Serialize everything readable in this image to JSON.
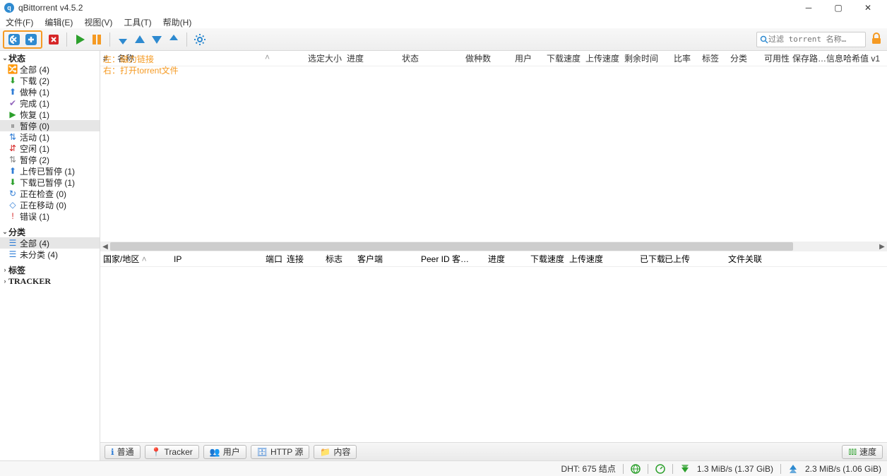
{
  "title": "qBittorrent v4.5.2",
  "menu": [
    "文件(F)",
    "编辑(E)",
    "视图(V)",
    "工具(T)",
    "帮助(H)"
  ],
  "search": {
    "placeholder": "过滤 torrent 名称…"
  },
  "annotations": {
    "line1": "左：磁力链接",
    "line2": "右：打开torrent文件"
  },
  "sidebar": {
    "status_label": "状态",
    "items": [
      {
        "icon": "🔀",
        "color": "c-orange",
        "label": "全部 (4)"
      },
      {
        "icon": "⬇",
        "color": "c-green",
        "label": "下载 (2)"
      },
      {
        "icon": "⬆",
        "color": "c-blue",
        "label": "做种 (1)"
      },
      {
        "icon": "✔",
        "color": "c-purple",
        "label": "完成 (1)"
      },
      {
        "icon": "▶",
        "color": "c-green",
        "label": "恢复 (1)"
      },
      {
        "icon": "⏸",
        "color": "c-gray",
        "label": "暂停 (0)",
        "sel": true
      },
      {
        "icon": "⇅",
        "color": "c-blue",
        "label": "活动 (1)"
      },
      {
        "icon": "⇵",
        "color": "c-red",
        "label": "空闲 (1)"
      },
      {
        "icon": "⇅",
        "color": "c-gray",
        "label": "暂停 (2)"
      },
      {
        "icon": "⬆",
        "color": "c-blue",
        "label": "上传已暂停 (1)"
      },
      {
        "icon": "⬇",
        "color": "c-green",
        "label": "下载已暂停 (1)"
      },
      {
        "icon": "↻",
        "color": "c-blue",
        "label": "正在检查 (0)"
      },
      {
        "icon": "◇",
        "color": "c-blue",
        "label": "正在移动 (0)"
      },
      {
        "icon": "!",
        "color": "c-red",
        "label": "错误 (1)"
      }
    ],
    "category_label": "分类",
    "cat_items": [
      {
        "label": "全部 (4)",
        "sel": true
      },
      {
        "label": "未分类 (4)"
      }
    ],
    "tags_label": "标签",
    "tracker_label": "TRACKER"
  },
  "torrent_cols": [
    "#",
    "名称",
    "选定大小",
    "进度",
    "状态",
    "做种数",
    "用户",
    "下载速度",
    "上传速度",
    "剩余时间",
    "比率",
    "标签",
    "分类",
    "可用性",
    "保存路…",
    "信息哈希值 v1"
  ],
  "peer_cols": [
    "国家/地区",
    "IP",
    "端口",
    "连接",
    "标志",
    "客户端",
    "Peer ID 客…",
    "进度",
    "下载速度",
    "上传速度",
    "已下载",
    "已上传",
    "文件关联"
  ],
  "tabs": [
    {
      "icon": "ℹ",
      "color": "c-blue",
      "label": "普通"
    },
    {
      "icon": "📍",
      "color": "c-blue",
      "label": "Tracker"
    },
    {
      "icon": "👥",
      "color": "c-blue",
      "label": "用户"
    },
    {
      "icon": "🗄",
      "color": "c-blue",
      "label": "HTTP 源"
    },
    {
      "icon": "📁",
      "color": "c-blue",
      "label": "内容"
    }
  ],
  "speed_tab": "速度",
  "status": {
    "dht": "DHT: 675 结点",
    "down": "1.3 MiB/s (1.37 GiB)",
    "up": "2.3 MiB/s (1.06 GiB)"
  }
}
